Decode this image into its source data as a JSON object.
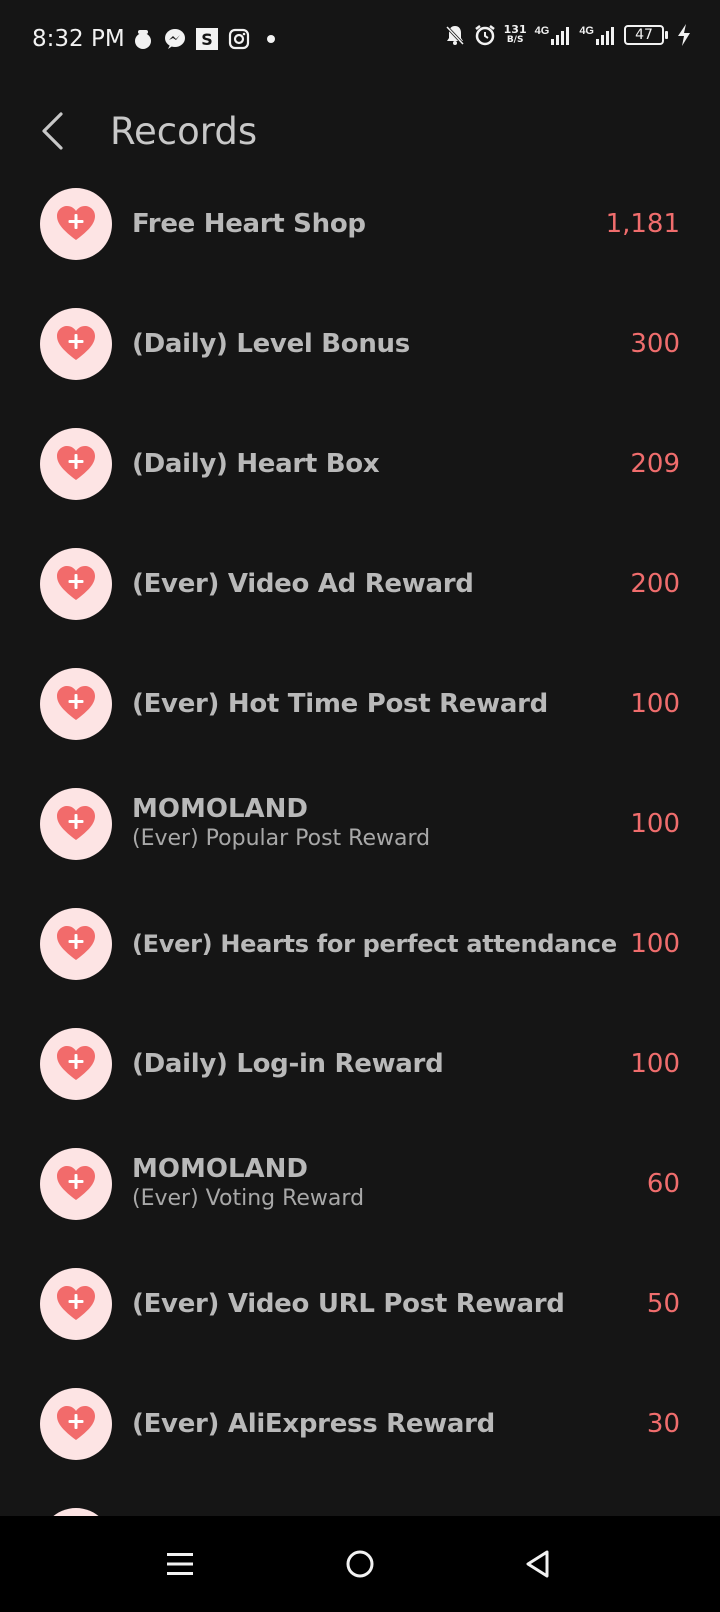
{
  "status_bar": {
    "time": "8:32 PM",
    "net_speed_value": "131",
    "net_speed_unit": "B/S",
    "network_1": "4G",
    "network_2": "4G",
    "battery": "47",
    "left_icons": [
      "notification-dot-icon",
      "messenger-icon",
      "s-app-icon",
      "instagram-icon",
      "dot-icon"
    ],
    "right_icons": [
      "muted-bell-icon",
      "alarm-icon",
      "signal-icon",
      "charging-icon"
    ]
  },
  "header": {
    "title": "Records"
  },
  "records": [
    {
      "title": "Free Heart Shop",
      "amount": "1,181"
    },
    {
      "title": "(Daily) Level Bonus",
      "amount": "300"
    },
    {
      "title": "(Daily) Heart Box",
      "amount": "209"
    },
    {
      "title": "(Ever) Video Ad Reward",
      "amount": "200"
    },
    {
      "title": "(Ever) Hot Time Post Reward",
      "amount": "100"
    },
    {
      "group": "MOMOLAND",
      "subtitle": "(Ever) Popular Post Reward",
      "amount": "100"
    },
    {
      "title": "(Ever) Hearts for perfect attendance",
      "amount": "100"
    },
    {
      "title": "(Daily) Log-in Reward",
      "amount": "100"
    },
    {
      "group": "MOMOLAND",
      "subtitle": "(Ever) Voting Reward",
      "amount": "60"
    },
    {
      "title": "(Ever) Video URL Post Reward",
      "amount": "50"
    },
    {
      "title": "(Ever) AliExpress Reward",
      "amount": "30"
    }
  ],
  "colors": {
    "background": "#151515",
    "accent_amount": "#f06d6d",
    "icon_bg": "#fde4e4",
    "heart": "#f26b6b"
  },
  "nav": {
    "icons": [
      "menu-icon",
      "home-icon",
      "back-triangle-icon"
    ]
  }
}
